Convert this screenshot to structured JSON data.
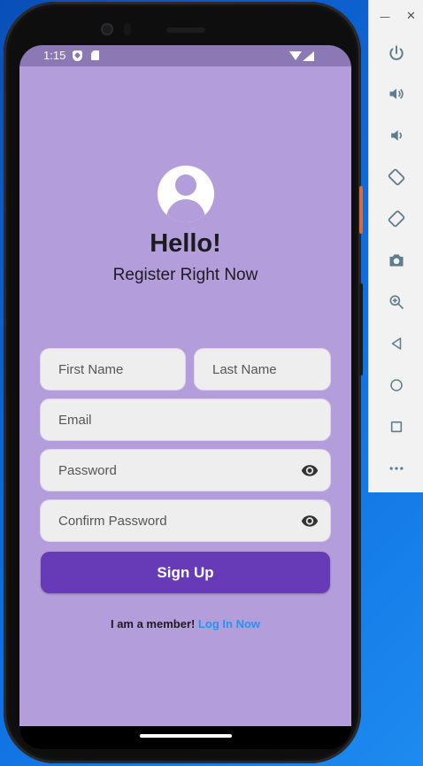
{
  "status_bar": {
    "time": "1:15"
  },
  "header": {
    "title": "Hello!",
    "subtitle": "Register Right Now"
  },
  "form": {
    "first_name_placeholder": "First Name",
    "last_name_placeholder": "Last Name",
    "email_placeholder": "Email",
    "password_placeholder": "Password",
    "confirm_password_placeholder": "Confirm Password",
    "signup_label": "Sign Up"
  },
  "footer": {
    "member_text": "I am a member!",
    "login_link": "Log In Now"
  },
  "colors": {
    "background": "#b39ddb",
    "button": "#673ab7",
    "field": "#eeeeee",
    "link": "#2196f3",
    "status_bar": "#8c78b5"
  },
  "emulator_panel": {
    "icons": [
      "power-icon",
      "volume-up-icon",
      "volume-down-icon",
      "rotate-left-icon",
      "rotate-right-icon",
      "camera-icon",
      "zoom-icon",
      "back-icon",
      "home-icon",
      "overview-icon",
      "more-icon"
    ]
  }
}
